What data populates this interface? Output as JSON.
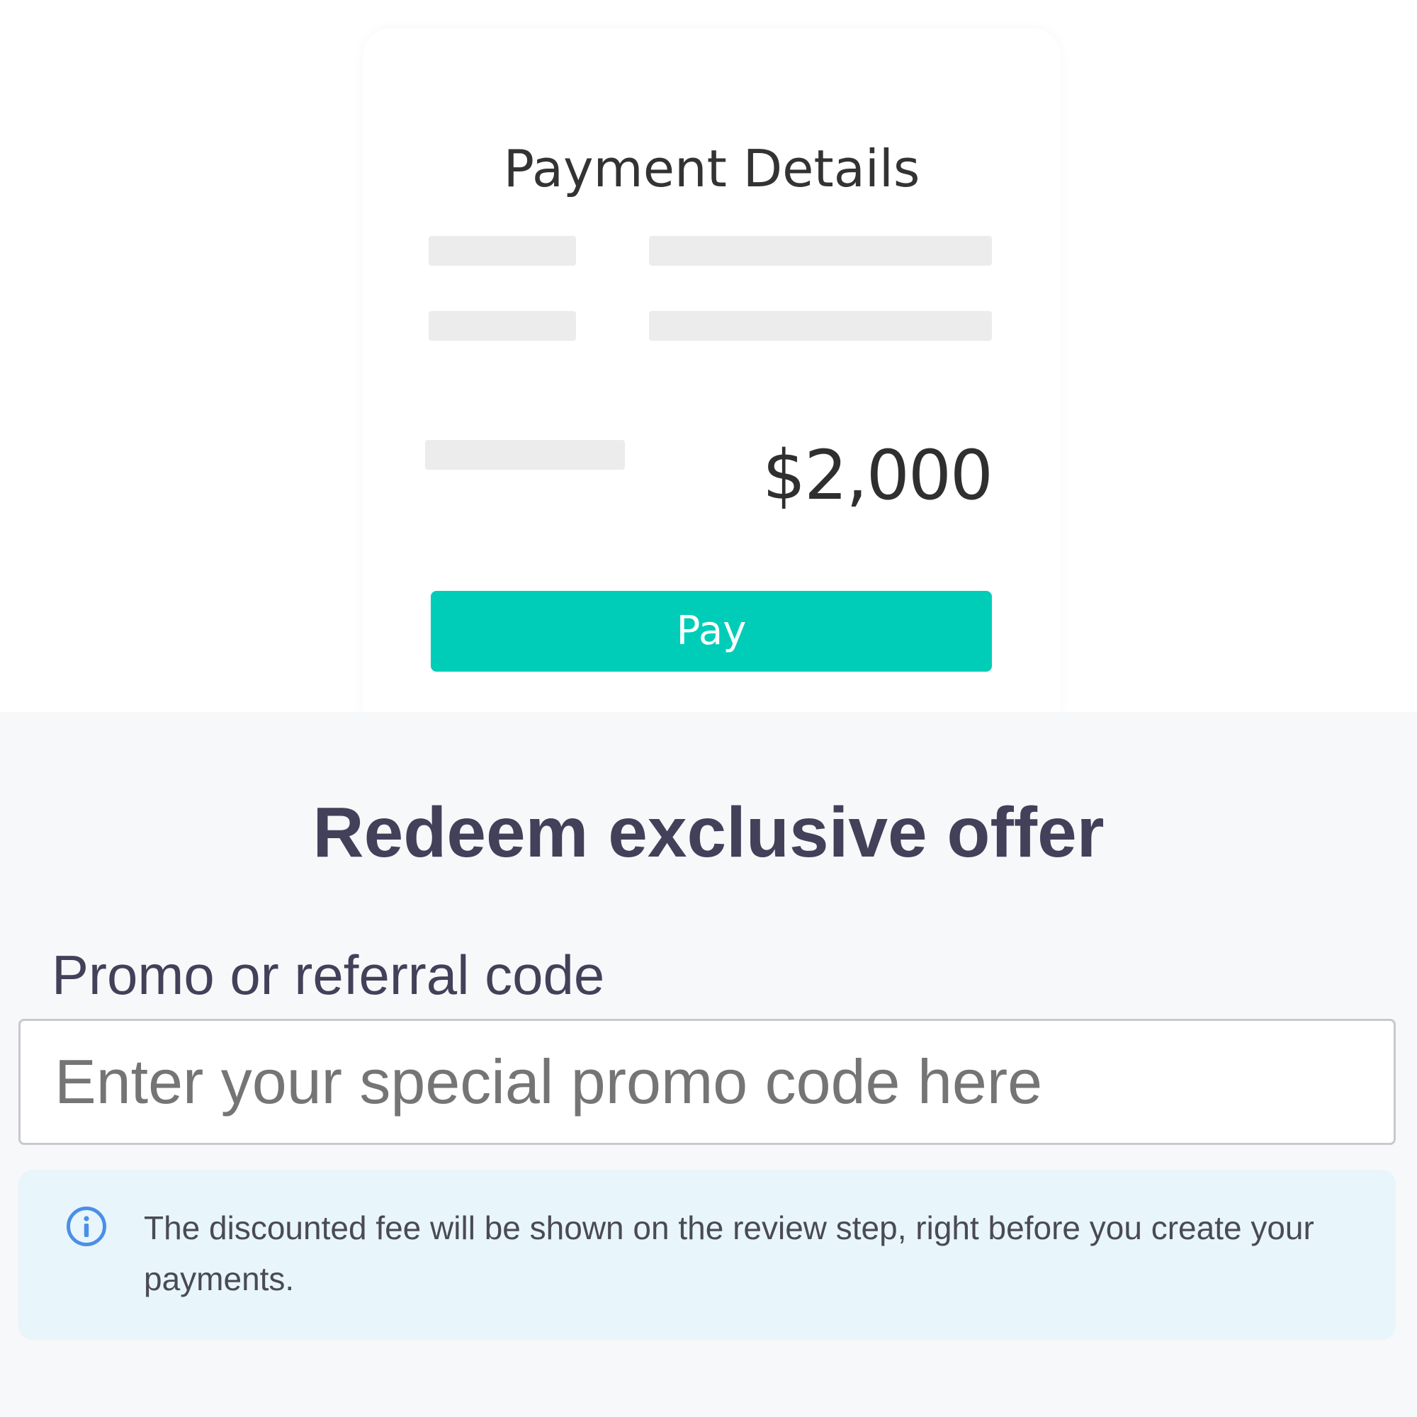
{
  "payment_card": {
    "title": "Payment Details",
    "amount": "$2,000",
    "pay_button_label": "Pay"
  },
  "promo": {
    "title": "Redeem exclusive offer",
    "field_label": "Promo or referral code",
    "input_value": "",
    "input_placeholder": "Enter your special promo code here",
    "info_text": "The discounted fee will be shown on the review step, right before you create your payments."
  },
  "icons": {
    "info": "info-icon"
  },
  "colors": {
    "pay_button": "#00cdb8",
    "heading_text": "#43405a",
    "info_background": "#e8f5fb",
    "info_icon": "#4a8fe8"
  }
}
